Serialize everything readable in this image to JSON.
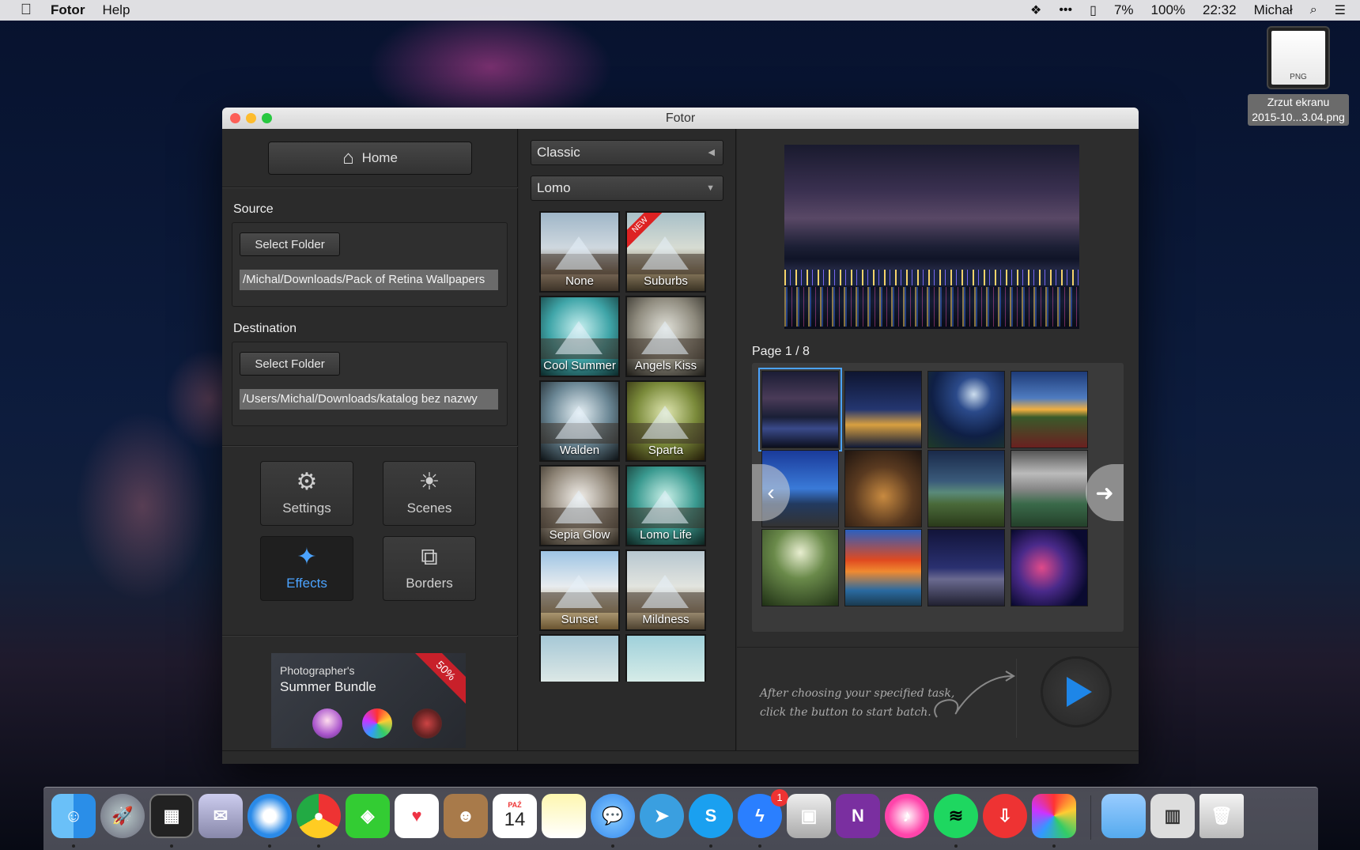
{
  "menubar": {
    "app_name": "Fotor",
    "menus": [
      "Help"
    ],
    "status": {
      "battery_small": "7%",
      "battery": "100%",
      "time": "22:32",
      "user": "Michał"
    }
  },
  "desktop_file": {
    "name_line1": "Zrzut ekranu",
    "name_line2": "2015-10...3.04.png",
    "type": "PNG"
  },
  "window": {
    "title": "Fotor"
  },
  "left": {
    "home_label": "Home",
    "source_label": "Source",
    "source_button": "Select Folder",
    "source_path": "/Michal/Downloads/Pack of Retina Wallpapers",
    "dest_label": "Destination",
    "dest_button": "Select Folder",
    "dest_path": "/Users/Michal/Downloads/katalog bez nazwy",
    "tools": {
      "settings": "Settings",
      "scenes": "Scenes",
      "effects": "Effects",
      "borders": "Borders"
    },
    "promo": {
      "line1": "Photographer's",
      "line2": "Summer Bundle",
      "ribbon": "50%"
    }
  },
  "middle": {
    "categories": [
      {
        "label": "Classic",
        "state": "collapsed"
      },
      {
        "label": "Lomo",
        "state": "expanded"
      }
    ],
    "effects": [
      "None",
      "Suburbs",
      "Cool Summer",
      "Angels Kiss",
      "Walden",
      "Sparta",
      "Sepia Glow",
      "Lomo Life",
      "Sunset",
      "Mildness"
    ],
    "new_badge": "NEW"
  },
  "right": {
    "page_label": "Page 1 / 8",
    "hint_line1": "After choosing your specified task,",
    "hint_line2": "click the button to start batch."
  },
  "dock": {
    "calendar_month": "PAŹ",
    "calendar_day": "14",
    "messenger_badge": "1"
  }
}
